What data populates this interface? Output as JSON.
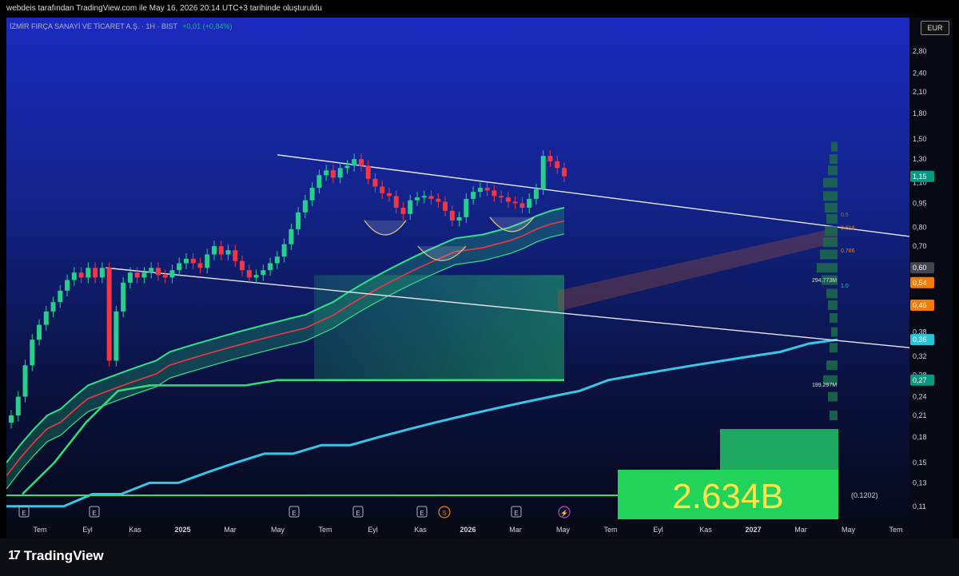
{
  "header": {
    "caption": "webdeis tarafından TradingView.com ile May 16, 2026 20:14 UTC+3 tarihinde oluşturuldu"
  },
  "legend": {
    "symbol": "İZMİR FIRÇA SANAYİ VE TİCARET A.Ş. · 1H · BIST",
    "change": "+0,01 (+0,84%)"
  },
  "currency": "EUR",
  "branding": {
    "logo_mark": "17",
    "name": "TradingView"
  },
  "big_label": "2.634B",
  "side_note": "(0.1202)",
  "chart_data": {
    "type": "line",
    "scale": "log",
    "ylim": [
      0.1,
      3.3
    ],
    "y_ticks": [
      "2,80",
      "2,40",
      "2,10",
      "1,80",
      "1,50",
      "1,30",
      "1,10",
      "0,95",
      "0,80",
      "0,70",
      "0,38",
      "0,32",
      "0,28",
      "0,24",
      "0,21",
      "0,18",
      "0,15",
      "0,13",
      "0,11"
    ],
    "x_ticks": [
      "Tem",
      "Eyl",
      "Kas",
      "2025",
      "Mar",
      "May",
      "Tem",
      "Eyl",
      "Kas",
      "2026",
      "Mar",
      "May",
      "Tem",
      "Eyl",
      "Kas",
      "2027",
      "Mar",
      "May",
      "Tem"
    ],
    "price_labels": [
      {
        "text": "1,15",
        "color": "#089981"
      },
      {
        "text": "0,60",
        "color": "#434651"
      },
      {
        "text": "0,54",
        "color": "#f57c00"
      },
      {
        "text": "0,46",
        "color": "#f57c00"
      },
      {
        "text": "0,36",
        "color": "#26c6da"
      },
      {
        "text": "0,27",
        "color": "#089981"
      }
    ],
    "fib_levels": [
      {
        "label": "0.5",
        "color": "#787b86"
      },
      {
        "label": "0.618",
        "color": "#f57c00"
      },
      {
        "label": "0.786",
        "color": "#f57c00"
      },
      {
        "label": "1.0",
        "color": "#26c6da"
      }
    ],
    "volume_profile_labels": [
      "294.773M",
      "199.297M"
    ],
    "event_markers": [
      "E",
      "E",
      "E",
      "E",
      "E",
      "S",
      "E",
      "⚡"
    ],
    "price_series": {
      "name": "",
      "values": [
        0.21,
        0.24,
        0.3,
        0.36,
        0.4,
        0.44,
        0.47,
        0.51,
        0.55,
        0.58,
        0.56,
        0.6,
        0.56,
        0.6,
        0.31,
        0.44,
        0.54,
        0.58,
        0.56,
        0.58,
        0.6,
        0.57,
        0.56,
        0.59,
        0.62,
        0.64,
        0.62,
        0.6,
        0.66,
        0.7,
        0.66,
        0.68,
        0.63,
        0.59,
        0.56,
        0.57,
        0.59,
        0.62,
        0.65,
        0.71,
        0.79,
        0.89,
        0.97,
        1.06,
        1.16,
        1.2,
        1.14,
        1.22,
        1.24,
        1.3,
        1.24,
        1.13,
        1.07,
        1.02,
        1.0,
        0.92,
        0.88,
        0.97,
        0.99,
        1.0,
        0.98,
        0.96,
        0.9,
        0.84,
        0.86,
        0.98,
        1.03,
        1.06,
        1.04,
        1.0,
        0.99,
        0.96,
        0.95,
        0.92,
        0.98,
        1.05,
        1.33,
        1.28,
        1.22,
        1.15
      ]
    },
    "channel_upper": [
      0.15,
      0.17,
      0.19,
      0.21,
      0.22,
      0.24,
      0.26,
      0.27,
      0.28,
      0.29,
      0.3,
      0.31,
      0.33,
      0.34,
      0.35,
      0.36,
      0.37,
      0.38,
      0.39,
      0.4,
      0.41,
      0.42,
      0.43,
      0.45,
      0.47,
      0.5,
      0.53,
      0.56,
      0.59,
      0.62,
      0.65,
      0.68,
      0.71,
      0.74,
      0.75,
      0.76,
      0.78,
      0.8,
      0.83,
      0.87,
      0.9,
      0.92
    ],
    "cyan_average": [
      0.11,
      0.11,
      0.11,
      0.12,
      0.12,
      0.13,
      0.13,
      0.14,
      0.15,
      0.16,
      0.16,
      0.17,
      0.17,
      0.18,
      0.19,
      0.2,
      0.21,
      0.22,
      0.23,
      0.24,
      0.25,
      0.27,
      0.28,
      0.29,
      0.3,
      0.31,
      0.32,
      0.33,
      0.35,
      0.36
    ],
    "green_step": [
      0.12,
      0.15,
      0.2,
      0.25,
      0.26,
      0.26,
      0.26,
      0.26,
      0.27,
      0.27,
      0.27,
      0.27,
      0.27,
      0.27,
      0.27,
      0.27,
      0.27,
      0.27
    ],
    "trendlines": [
      {
        "from": [
          0.3,
          1.34
        ],
        "to": [
          1.0,
          0.75
        ]
      },
      {
        "from": [
          0.11,
          0.6
        ],
        "to": [
          1.0,
          0.34
        ]
      }
    ]
  }
}
